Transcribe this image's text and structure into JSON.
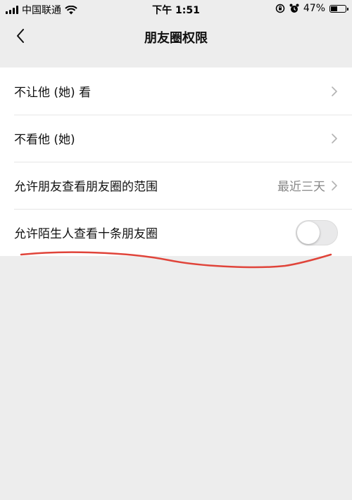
{
  "status_bar": {
    "carrier": "中国联通",
    "time": "下午 1:51",
    "battery": "47%",
    "battery_level": 0.47
  },
  "nav": {
    "title": "朋友圈权限",
    "back_icon": "chevron-left-icon"
  },
  "settings": {
    "items": [
      {
        "label": "不让他 (她) 看",
        "type": "link"
      },
      {
        "label": "不看他 (她)",
        "type": "link"
      },
      {
        "label": "允许朋友查看朋友圈的范围",
        "value": "最近三天",
        "type": "link"
      },
      {
        "label": "允许陌生人查看十条朋友圈",
        "type": "toggle",
        "enabled": false
      }
    ]
  },
  "colors": {
    "background": "#ededed",
    "annotation": "#e0443a"
  }
}
